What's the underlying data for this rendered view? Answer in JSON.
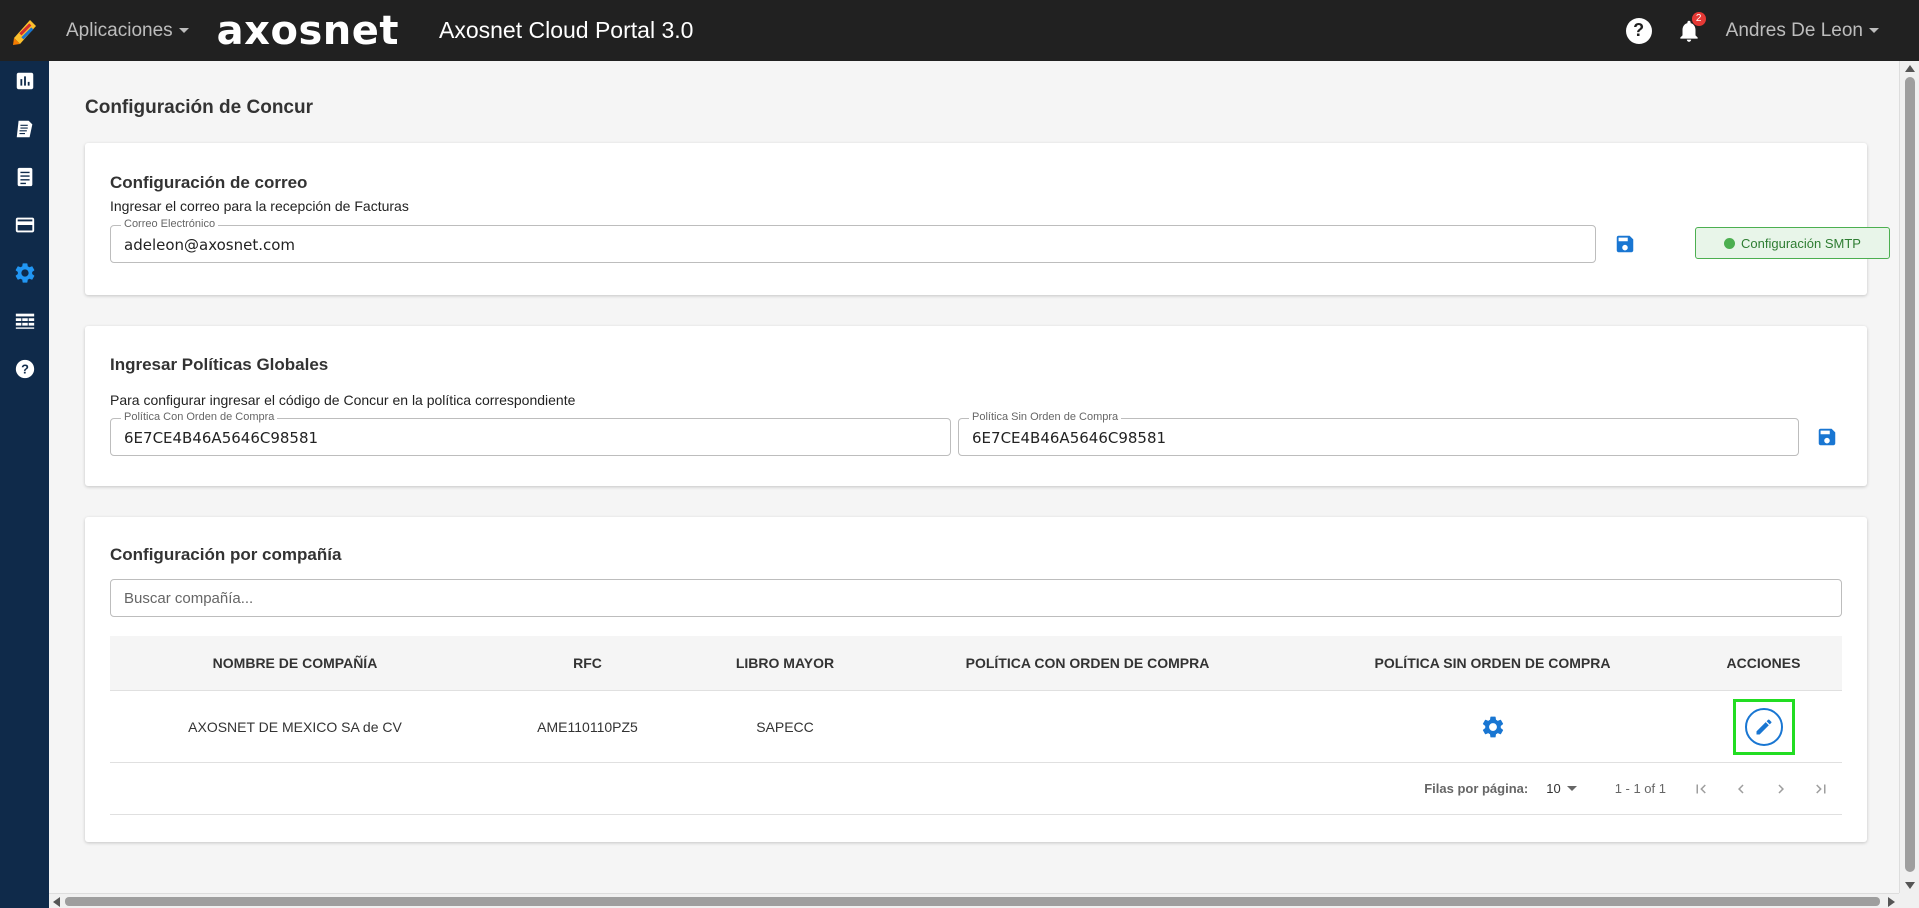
{
  "header": {
    "apps_menu": "Aplicaciones",
    "brand": "axosnet",
    "title": "Axosnet Cloud Portal 3.0",
    "help": "?",
    "notification_count": "2",
    "user": "Andres De Leon"
  },
  "sidebar": {
    "items": [
      {
        "icon": "bar-chart-icon"
      },
      {
        "icon": "receipt-icon"
      },
      {
        "icon": "document-icon"
      },
      {
        "icon": "credit-card-icon"
      },
      {
        "icon": "gear-icon",
        "active": true
      },
      {
        "icon": "table-icon"
      },
      {
        "icon": "help-icon"
      }
    ]
  },
  "page": {
    "title": "Configuración de Concur"
  },
  "email_config": {
    "title": "Configuración de correo",
    "subtitle": "Ingresar el correo para la recepción de Facturas",
    "field_label": "Correo Electrónico",
    "field_value": "adeleon@axosnet.com",
    "smtp_label": "Configuración SMTP"
  },
  "global_policies": {
    "title": "Ingresar Políticas Globales",
    "subtitle": "Para configurar ingresar el código de Concur en la política correspondiente",
    "with_po_label": "Política Con Orden de Compra",
    "with_po_value": "6E7CE4B46A5646C98581",
    "without_po_label": "Política Sin Orden de Compra",
    "without_po_value": "6E7CE4B46A5646C98581"
  },
  "company_config": {
    "title": "Configuración por compañía",
    "search_placeholder": "Buscar compañía...",
    "columns": [
      "NOMBRE DE COMPAÑÍA",
      "RFC",
      "LIBRO MAYOR",
      "POLÍTICA CON ORDEN DE COMPRA",
      "POLÍTICA SIN ORDEN DE COMPRA",
      "ACCIONES"
    ],
    "rows": [
      {
        "name": "AXOSNET DE MEXICO SA de CV",
        "rfc": "AME110110PZ5",
        "ledger": "SAPECC",
        "with_po": "",
        "without_po": "gear-icon",
        "actions": "edit-icon"
      }
    ],
    "pagination": {
      "rows_label": "Filas por página:",
      "rows_value": "10",
      "range": "1 - 1 of 1"
    }
  },
  "colors": {
    "topbar": "#212121",
    "sidebar": "#0f2a4a",
    "accent": "#1976d2",
    "highlight": "#22dd22",
    "smtp_green": "#4caf50"
  }
}
